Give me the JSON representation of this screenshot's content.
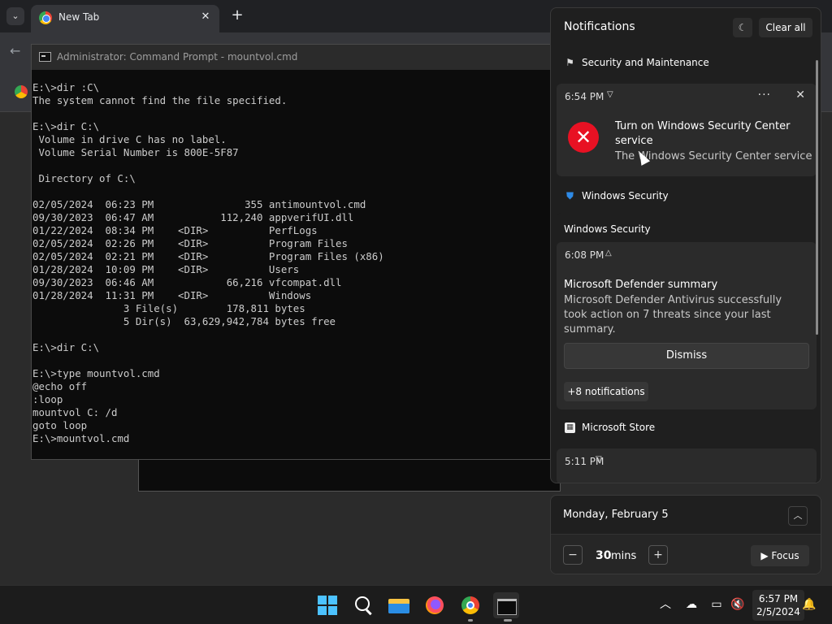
{
  "chrome": {
    "tab_title": "New Tab",
    "tab_close": "✕",
    "new_tab": "+",
    "back": "←",
    "tab_search": "⌄"
  },
  "cmd": {
    "title": "Administrator: Command Prompt - mountvol.cmd",
    "lines": [
      "E:\\>dir :C\\",
      "The system cannot find the file specified.",
      "",
      "E:\\>dir C:\\",
      " Volume in drive C has no label.",
      " Volume Serial Number is 800E-5F87",
      "",
      " Directory of C:\\",
      "",
      "02/05/2024  06:23 PM               355 antimountvol.cmd",
      "09/30/2023  06:47 AM           112,240 appverifUI.dll",
      "01/22/2024  08:34 PM    <DIR>          PerfLogs",
      "02/05/2024  02:26 PM    <DIR>          Program Files",
      "02/05/2024  02:21 PM    <DIR>          Program Files (x86)",
      "01/28/2024  10:09 PM    <DIR>          Users",
      "09/30/2023  06:46 AM            66,216 vfcompat.dll",
      "01/28/2024  11:31 PM    <DIR>          Windows",
      "               3 File(s)        178,811 bytes",
      "               5 Dir(s)  63,629,942,784 bytes free",
      "",
      "E:\\>dir C:\\",
      "",
      "E:\\>type mountvol.cmd",
      "@echo off",
      ":loop",
      "mountvol C: /d",
      "goto loop",
      "E:\\>mountvol.cmd"
    ]
  },
  "notifications": {
    "title": "Notifications",
    "clear_all": "Clear all",
    "groups": [
      {
        "app": "Security and Maintenance",
        "time": "6:54 PM",
        "heading": "Turn on Windows Security Center service",
        "body": "The Windows Security Center service"
      },
      {
        "app": "Windows Security",
        "subheader": "Windows Security",
        "time": "6:08 PM",
        "heading": "Microsoft Defender summary",
        "body": "Microsoft Defender Antivirus successfully took action on 7 threats since your last summary.",
        "dismiss": "Dismiss",
        "more": "+8 notifications"
      },
      {
        "app": "Microsoft Store",
        "time": "5:11 PM"
      }
    ]
  },
  "calendar": {
    "date": "Monday, February 5",
    "focus_value": "30",
    "focus_unit": "mins",
    "focus_label": "Focus"
  },
  "taskbar": {
    "time": "6:57 PM",
    "date": "2/5/2024"
  },
  "colors": {
    "accent": "#4cc2ff",
    "error": "#e81123"
  }
}
